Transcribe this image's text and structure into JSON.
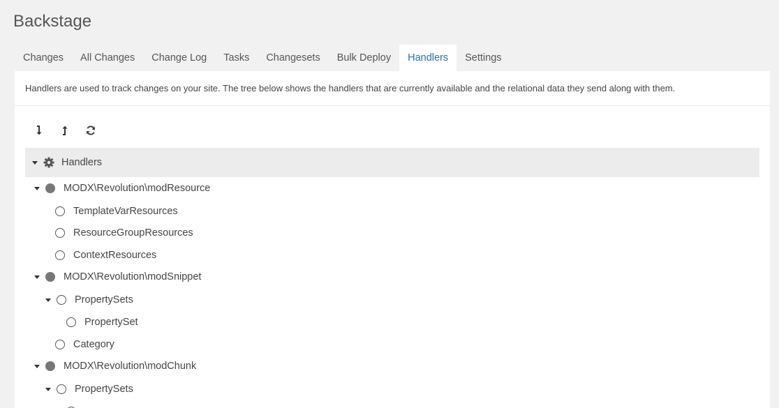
{
  "app": {
    "title": "Backstage"
  },
  "tabs": [
    {
      "label": "Changes"
    },
    {
      "label": "All Changes"
    },
    {
      "label": "Change Log"
    },
    {
      "label": "Tasks"
    },
    {
      "label": "Changesets"
    },
    {
      "label": "Bulk Deploy"
    },
    {
      "label": "Handlers",
      "active": true
    },
    {
      "label": "Settings"
    }
  ],
  "description": "Handlers are used to track changes on your site. The tree below shows the handlers that are currently available and the relational data they send along with them.",
  "toolbar": {
    "buttons": [
      {
        "icon": "expand-all-icon"
      },
      {
        "icon": "collapse-all-icon"
      },
      {
        "icon": "refresh-icon"
      }
    ]
  },
  "tree": {
    "root": {
      "label": "Handlers",
      "icon": "gear-icon"
    },
    "nodes": [
      {
        "label": "MODX\\Revolution\\modResource",
        "type": "handler"
      },
      {
        "label": "TemplateVarResources",
        "type": "relation"
      },
      {
        "label": "ResourceGroupResources",
        "type": "relation"
      },
      {
        "label": "ContextResources",
        "type": "relation"
      },
      {
        "label": "MODX\\Revolution\\modSnippet",
        "type": "handler"
      },
      {
        "label": "PropertySets",
        "type": "relation"
      },
      {
        "label": "PropertySet",
        "type": "relation"
      },
      {
        "label": "Category",
        "type": "relation"
      },
      {
        "label": "MODX\\Revolution\\modChunk",
        "type": "handler"
      },
      {
        "label": "PropertySets",
        "type": "relation"
      }
    ]
  }
}
